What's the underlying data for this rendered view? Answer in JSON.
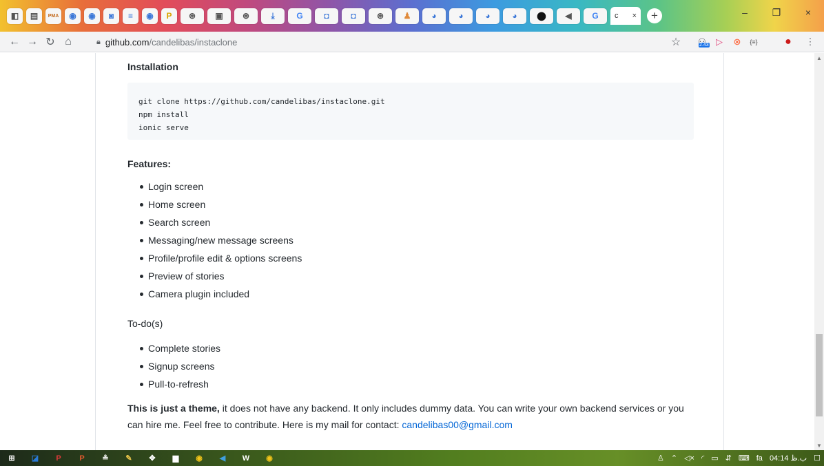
{
  "browser": {
    "active_tab_label": "c",
    "new_tab_symbol": "+",
    "window_controls": {
      "minimize": "–",
      "maximize": "❐",
      "close": "×"
    },
    "tab_icons": [
      "puzzle-icon",
      "dashboard-icon",
      "pma-icon",
      "chrome-icon",
      "chrome-icon",
      "chrome-icon",
      "list-icon",
      "chrome-icon",
      "p-icon",
      "globe-icon",
      "app-icon",
      "globe-icon",
      "download-icon",
      "google-icon",
      "box-icon",
      "box-icon",
      "globe-icon",
      "person-icon",
      "edge-icon",
      "edge-icon",
      "edge-icon",
      "edge-icon",
      "github-icon",
      "audio-icon",
      "google-icon"
    ],
    "pma_label": "PMA",
    "url": {
      "host": "github.com",
      "path": "/candelibas/instaclone"
    },
    "extension_badge": "2.43",
    "extension_brackets": "{≡}"
  },
  "readme": {
    "installation": {
      "heading": "Installation",
      "code_lines": [
        "git clone https://github.com/candelibas/instaclone.git",
        "npm install",
        "ionic serve"
      ]
    },
    "features": {
      "heading": "Features:",
      "items": [
        "Login screen",
        "Home screen",
        "Search screen",
        "Messaging/new message screens",
        "Profile/profile edit & options screens",
        "Preview of stories",
        "Camera plugin included"
      ]
    },
    "todo": {
      "heading": "To-do(s)",
      "items": [
        "Complete stories",
        "Signup screens",
        "Pull-to-refresh"
      ]
    },
    "note": {
      "bold": "This is just a theme,",
      "text": " it does not have any backend. It only includes dummy data. You can write your own backend services or you can hire me. Feel free to contribute. Here is my mail for contact: ",
      "email": "candelibas00@gmail.com"
    }
  },
  "taskbar": {
    "time": "04:14 ب.ظ",
    "lang": "fa",
    "tray_icons": [
      "people-icon",
      "chevron-up-icon",
      "volume-icon",
      "wifi-icon",
      "battery-icon",
      "network-icon",
      "keyboard-icon"
    ],
    "apps": [
      "windows-start-icon",
      "outlook-icon",
      "p-app-icon",
      "powerpoint-icon",
      "app-icon",
      "explorer-icon",
      "app-icon",
      "app-icon",
      "chrome-icon",
      "telegram-icon",
      "word-icon",
      "chrome-icon"
    ]
  },
  "colors": {
    "link": "#0366d6",
    "text": "#24292e",
    "code_bg": "#f6f8fa"
  }
}
